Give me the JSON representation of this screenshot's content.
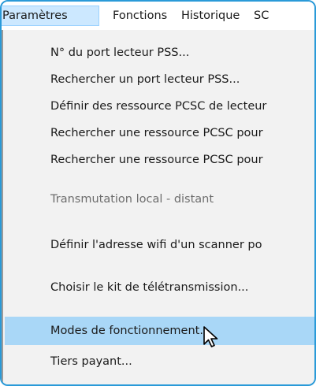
{
  "menubar": {
    "items": [
      {
        "label": "Paramètres"
      },
      {
        "label": "Fonctions"
      },
      {
        "label": "Historique"
      },
      {
        "label": "SC"
      }
    ]
  },
  "menu": {
    "items": [
      {
        "label": "N° du port lecteur PSS..."
      },
      {
        "label": "Rechercher un port lecteur PSS..."
      },
      {
        "label": "Définir des ressource PCSC de lecteur"
      },
      {
        "label": "Rechercher une ressource PCSC pour"
      },
      {
        "label": "Rechercher une ressource PCSC pour"
      },
      {
        "label": "Transmutation local - distant"
      },
      {
        "label": "Définir l'adresse wifi d'un scanner po"
      },
      {
        "label": "Choisir le kit de télétransmission..."
      },
      {
        "label": "Modes de fonctionnement..."
      },
      {
        "label": "Tiers payant..."
      }
    ]
  },
  "colors": {
    "accent_border": "#2a9ad8",
    "menu_background": "#f2f2f2",
    "highlight": "#a9d7f7",
    "disabled_text": "#6d6d6d"
  }
}
